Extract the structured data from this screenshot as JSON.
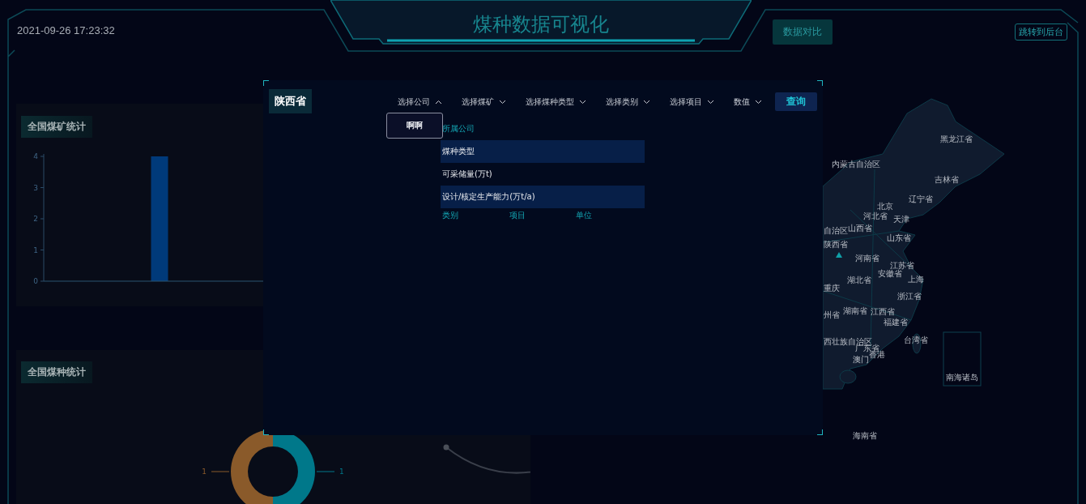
{
  "header": {
    "datetime": "2021-09-26 17:23:32",
    "title": "煤种数据可视化",
    "compare_button": "数据对比",
    "backend_button": "跳转到后台"
  },
  "panels": [
    {
      "title": "全国煤矿统计",
      "chart_data": {
        "type": "bar",
        "values": [
          4,
          0
        ],
        "ylim": [
          0,
          4
        ],
        "yticks": [
          0,
          1,
          2,
          3,
          4
        ]
      }
    },
    {
      "title": "全国煤种统计",
      "chart_data": {
        "type": "donut",
        "values": [
          1,
          1
        ],
        "data_labels": true
      }
    }
  ],
  "map": {
    "labels": [
      "黑龙江省",
      "内蒙古自治区",
      "吉林省",
      "辽宁省",
      "北京",
      "河北省",
      "天津",
      "自治区",
      "山西省",
      "山东省",
      "陕西省",
      "河南省",
      "江苏省",
      "安徽省",
      "上海",
      "湖北省",
      "重庆",
      "浙江省",
      "州省",
      "湖南省",
      "江西省",
      "福建省",
      "台湾省",
      "西壮族自治区",
      "广东省",
      "香港",
      "澳门",
      "南海诸岛",
      "海南省"
    ]
  },
  "modal": {
    "region": "陕西省",
    "filters": [
      {
        "label": "选择公司",
        "expanded": true,
        "options": [
          "啊啊"
        ]
      },
      {
        "label": "选择煤矿",
        "expanded": false
      },
      {
        "label": "选择煤种类型",
        "expanded": false
      },
      {
        "label": "选择类别",
        "expanded": false
      },
      {
        "label": "选择项目",
        "expanded": false
      },
      {
        "label": "数值",
        "expanded": false
      }
    ],
    "query_button": "查询",
    "table": {
      "header": "所属公司",
      "rows": [
        "煤种类型",
        "可采储量(万t)",
        "设计/核定生产能力(万t/a)"
      ],
      "columns": [
        "类别",
        "项目",
        "单位"
      ]
    }
  }
}
